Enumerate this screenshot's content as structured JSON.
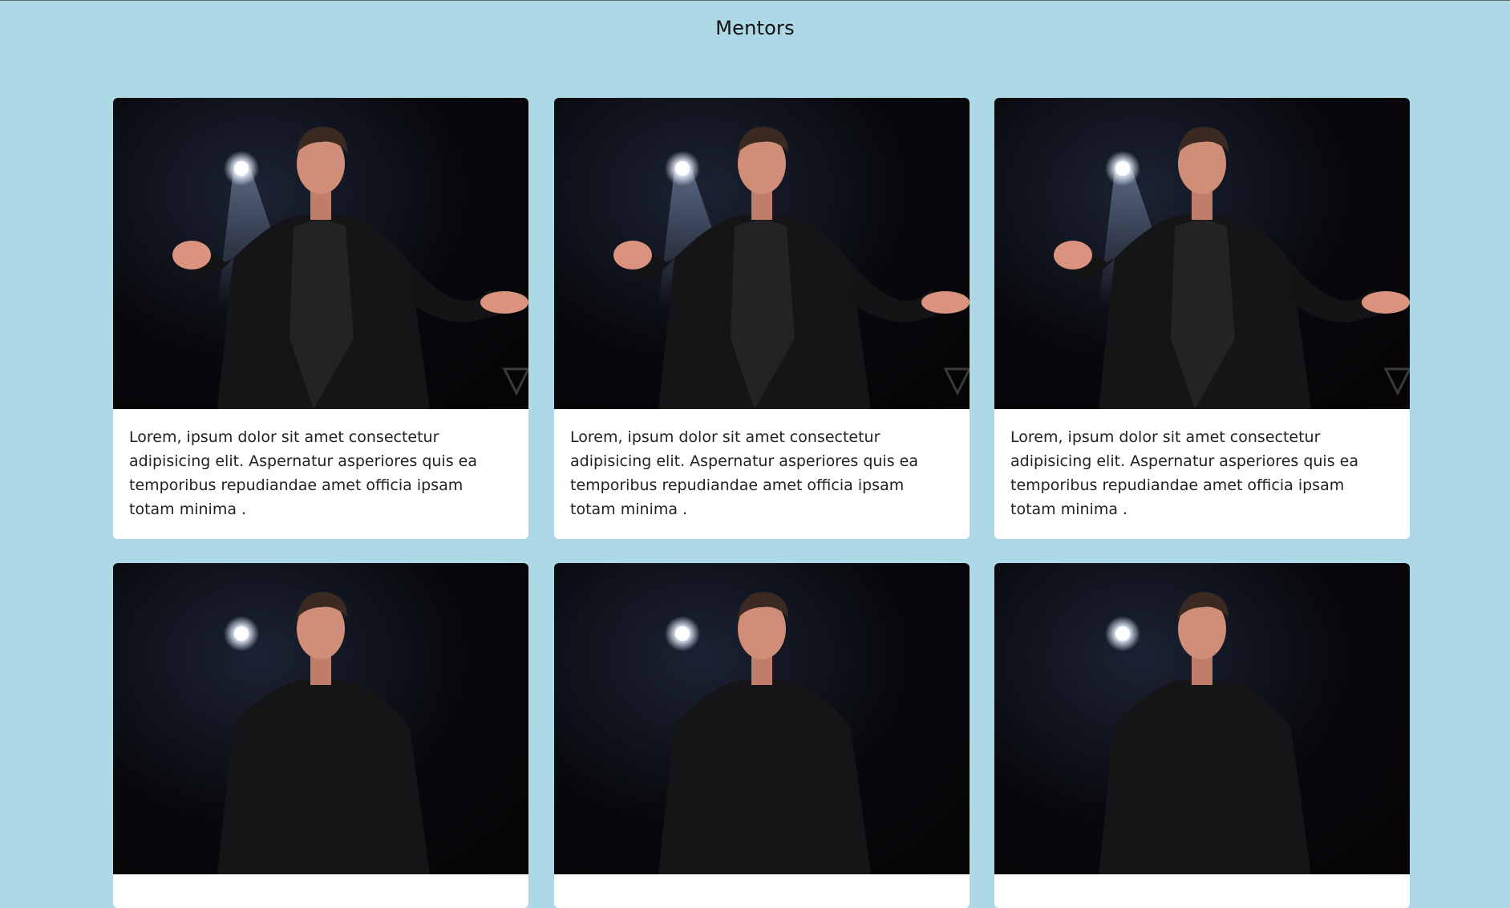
{
  "page": {
    "title": "Mentors"
  },
  "mentors": [
    {
      "photo_alt": "mentor-photo",
      "description": "Lorem, ipsum dolor sit amet consectetur adipisicing elit. Aspernatur asperiores quis ea temporibus repudiandae amet officia ipsam totam minima ."
    },
    {
      "photo_alt": "mentor-photo",
      "description": "Lorem, ipsum dolor sit amet consectetur adipisicing elit. Aspernatur asperiores quis ea temporibus repudiandae amet officia ipsam totam minima ."
    },
    {
      "photo_alt": "mentor-photo",
      "description": "Lorem, ipsum dolor sit amet consectetur adipisicing elit. Aspernatur asperiores quis ea temporibus repudiandae amet officia ipsam totam minima ."
    },
    {
      "photo_alt": "mentor-photo",
      "description": ""
    },
    {
      "photo_alt": "mentor-photo",
      "description": ""
    },
    {
      "photo_alt": "mentor-photo",
      "description": ""
    }
  ],
  "colors": {
    "background": "#add8e6",
    "card": "#ffffff",
    "photo_background": "#06070a"
  }
}
